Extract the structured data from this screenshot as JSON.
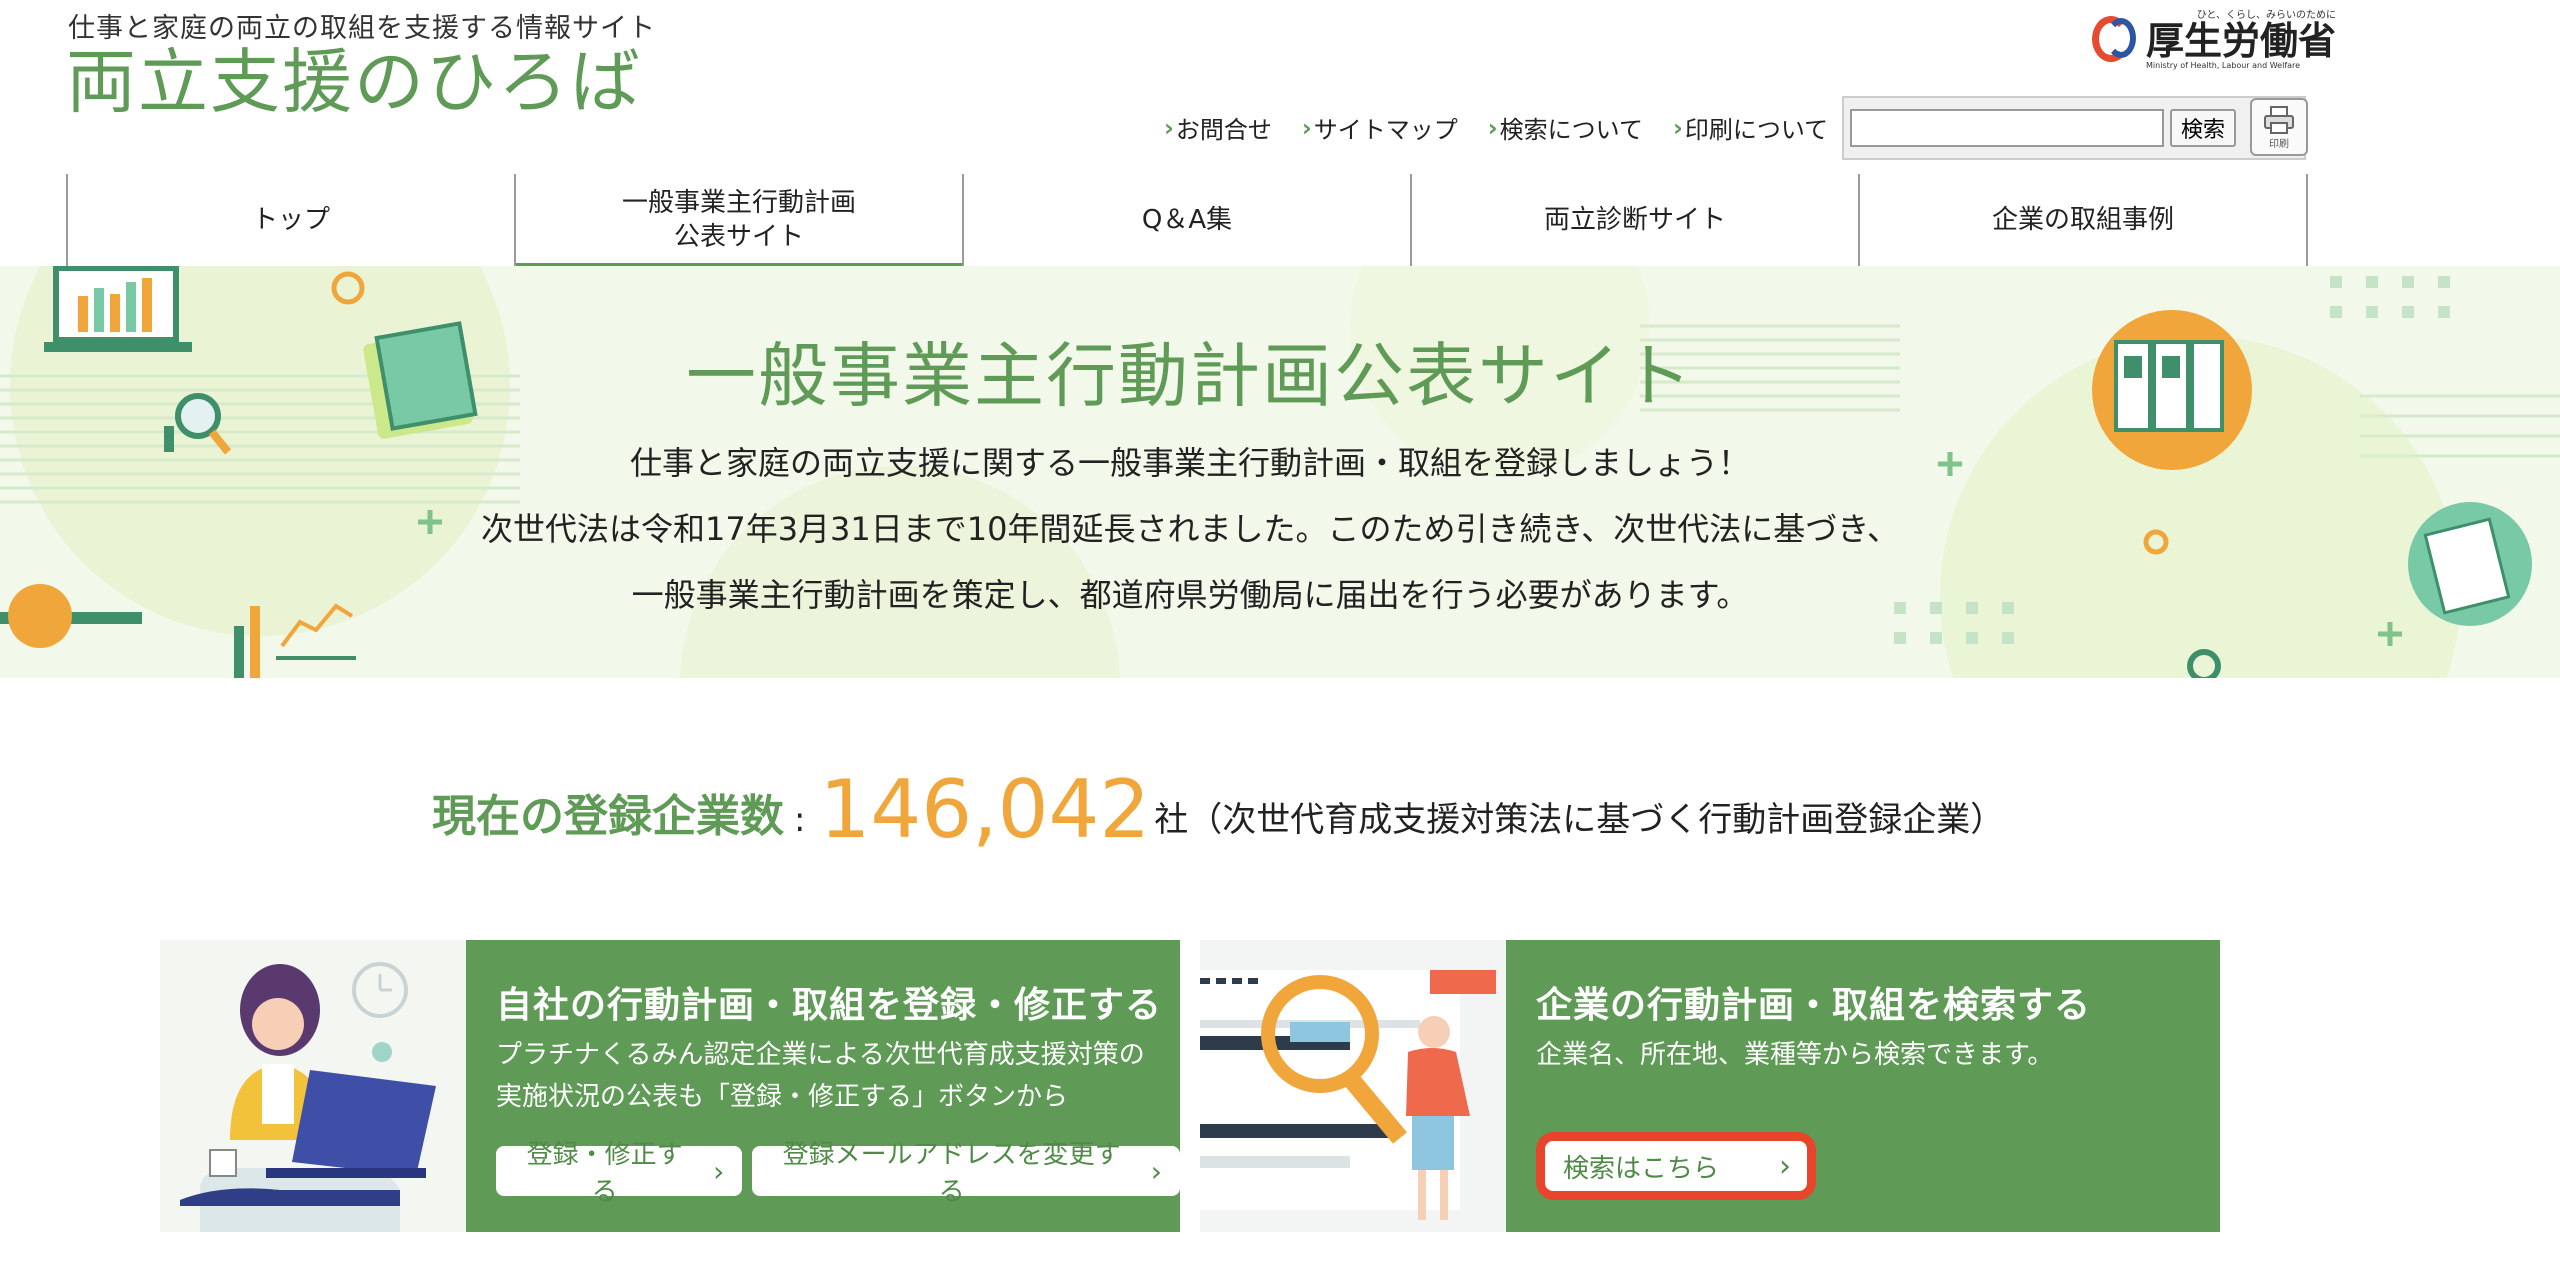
{
  "header": {
    "tagline": "仕事と家庭の両立の取組を支援する情報サイト",
    "site_title": "両立支援のひろば",
    "ministry_logo": {
      "sub": "ひと、くらし、みらいのために",
      "name": "厚生労働省",
      "en": "Ministry of Health, Labour and Welfare"
    },
    "util_links": [
      {
        "label": "お問合せ"
      },
      {
        "label": "サイトマップ"
      },
      {
        "label": "検索について"
      },
      {
        "label": "印刷について"
      }
    ],
    "search": {
      "value": "",
      "button_label": "検索"
    },
    "print_label": "印刷"
  },
  "nav": {
    "items": [
      {
        "label": "トップ"
      },
      {
        "label": "一般事業主行動計画\n公表サイト",
        "active": true
      },
      {
        "label": "Q＆A集"
      },
      {
        "label": "両立診断サイト"
      },
      {
        "label": "企業の取組事例"
      }
    ]
  },
  "hero": {
    "title": "一般事業主行動計画公表サイト",
    "line1": "仕事と家庭の両立支援に関する一般事業主行動計画・取組を登録しましょう！",
    "line2": "次世代法は令和17年3月31日まで10年間延長されました。このため引き続き、次世代法に基づき、",
    "line3": "一般事業主行動計画を策定し、都道府県労働局に届出を行う必要があります。"
  },
  "registration": {
    "label": "現在の登録企業数",
    "colon": ":",
    "count": "146,042",
    "unit": "社（次世代育成支援対策法に基づく行動計画登録企業）"
  },
  "cards": {
    "register": {
      "title": "自社の行動計画・取組を登録・修正する",
      "desc1": "プラチナくるみん認定企業による次世代育成支援対策の",
      "desc2": "実施状況の公表も「登録・修正する」ボタンから",
      "btn_register": "登録・修正する",
      "btn_change_email": "登録メールアドレスを変更する"
    },
    "search": {
      "title": "企業の行動計画・取組を検索する",
      "desc": "企業名、所在地、業種等から検索できます。",
      "btn_search": "検索はこちら"
    }
  },
  "colors": {
    "brand_green": "#5f9b57",
    "accent_orange": "#f0a63a",
    "highlight_red": "#e8442c",
    "hero_bg": "#f2f8ea"
  }
}
